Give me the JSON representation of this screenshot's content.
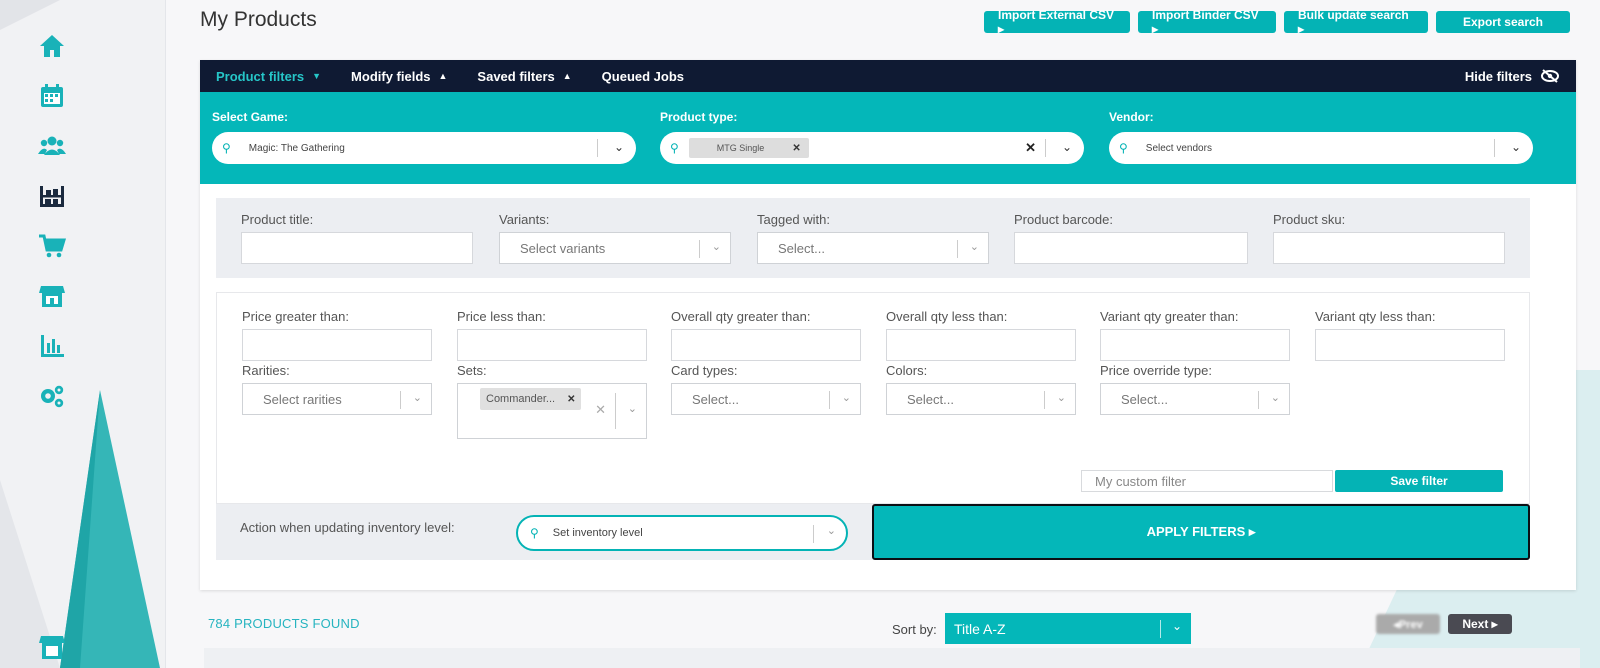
{
  "page": {
    "title": "My Products"
  },
  "top_buttons": [
    {
      "label": "Import External CSV ▸"
    },
    {
      "label": "Import Binder CSV ▸"
    },
    {
      "label": "Bulk update search ▸"
    },
    {
      "label": "Export search"
    }
  ],
  "tabs": {
    "product_filters": "Product filters",
    "modify_fields": "Modify fields",
    "saved_filters": "Saved filters",
    "queued_jobs": "Queued Jobs",
    "hide_filters": "Hide filters"
  },
  "top_filters": {
    "game": {
      "label": "Select Game:",
      "value": "Magic: The Gathering"
    },
    "product_type": {
      "label": "Product type:",
      "chip": "MTG Single"
    },
    "vendor": {
      "label": "Vendor:",
      "placeholder": "Select vendors"
    }
  },
  "filters_row1": {
    "product_title": {
      "label": "Product title:"
    },
    "variants": {
      "label": "Variants:",
      "placeholder": "Select variants"
    },
    "tagged_with": {
      "label": "Tagged with:",
      "placeholder": "Select..."
    },
    "product_barcode": {
      "label": "Product barcode:"
    },
    "product_sku": {
      "label": "Product sku:"
    }
  },
  "filters_row2": {
    "price_gt": {
      "label": "Price greater than:"
    },
    "price_lt": {
      "label": "Price less than:"
    },
    "overall_qty_gt": {
      "label": "Overall qty greater than:"
    },
    "overall_qty_lt": {
      "label": "Overall qty less than:"
    },
    "variant_qty_gt": {
      "label": "Variant qty greater than:"
    },
    "variant_qty_lt": {
      "label": "Variant qty less than:"
    },
    "rarities": {
      "label": "Rarities:",
      "placeholder": "Select rarities"
    },
    "sets": {
      "label": "Sets:",
      "chip": "Commander..."
    },
    "card_types": {
      "label": "Card types:",
      "placeholder": "Select..."
    },
    "colors": {
      "label": "Colors:",
      "placeholder": "Select..."
    },
    "price_override_type": {
      "label": "Price override type:",
      "placeholder": "Select..."
    }
  },
  "custom_filter": {
    "placeholder": "My custom filter",
    "save_label": "Save filter"
  },
  "action": {
    "label": "Action when updating inventory level:",
    "value": "Set inventory level"
  },
  "apply": {
    "label": "APPLY FILTERS ▸"
  },
  "results": {
    "found": "784 PRODUCTS FOUND",
    "sort_label": "Sort by:",
    "sort_value": "Title A-Z",
    "prev": "◂Prev",
    "next": "Next ▸"
  },
  "colors": {
    "accent": "#04b7b9",
    "navbar": "#0f1a33",
    "dark_button": "#4a4a52"
  },
  "icons": [
    "home-icon",
    "calendar-icon",
    "users-icon",
    "inventory-icon",
    "cart-icon",
    "store-icon",
    "reports-icon",
    "settings-icon",
    "store-bottom-icon",
    "search-icon",
    "chevron-down-icon",
    "eye-slash-icon"
  ]
}
